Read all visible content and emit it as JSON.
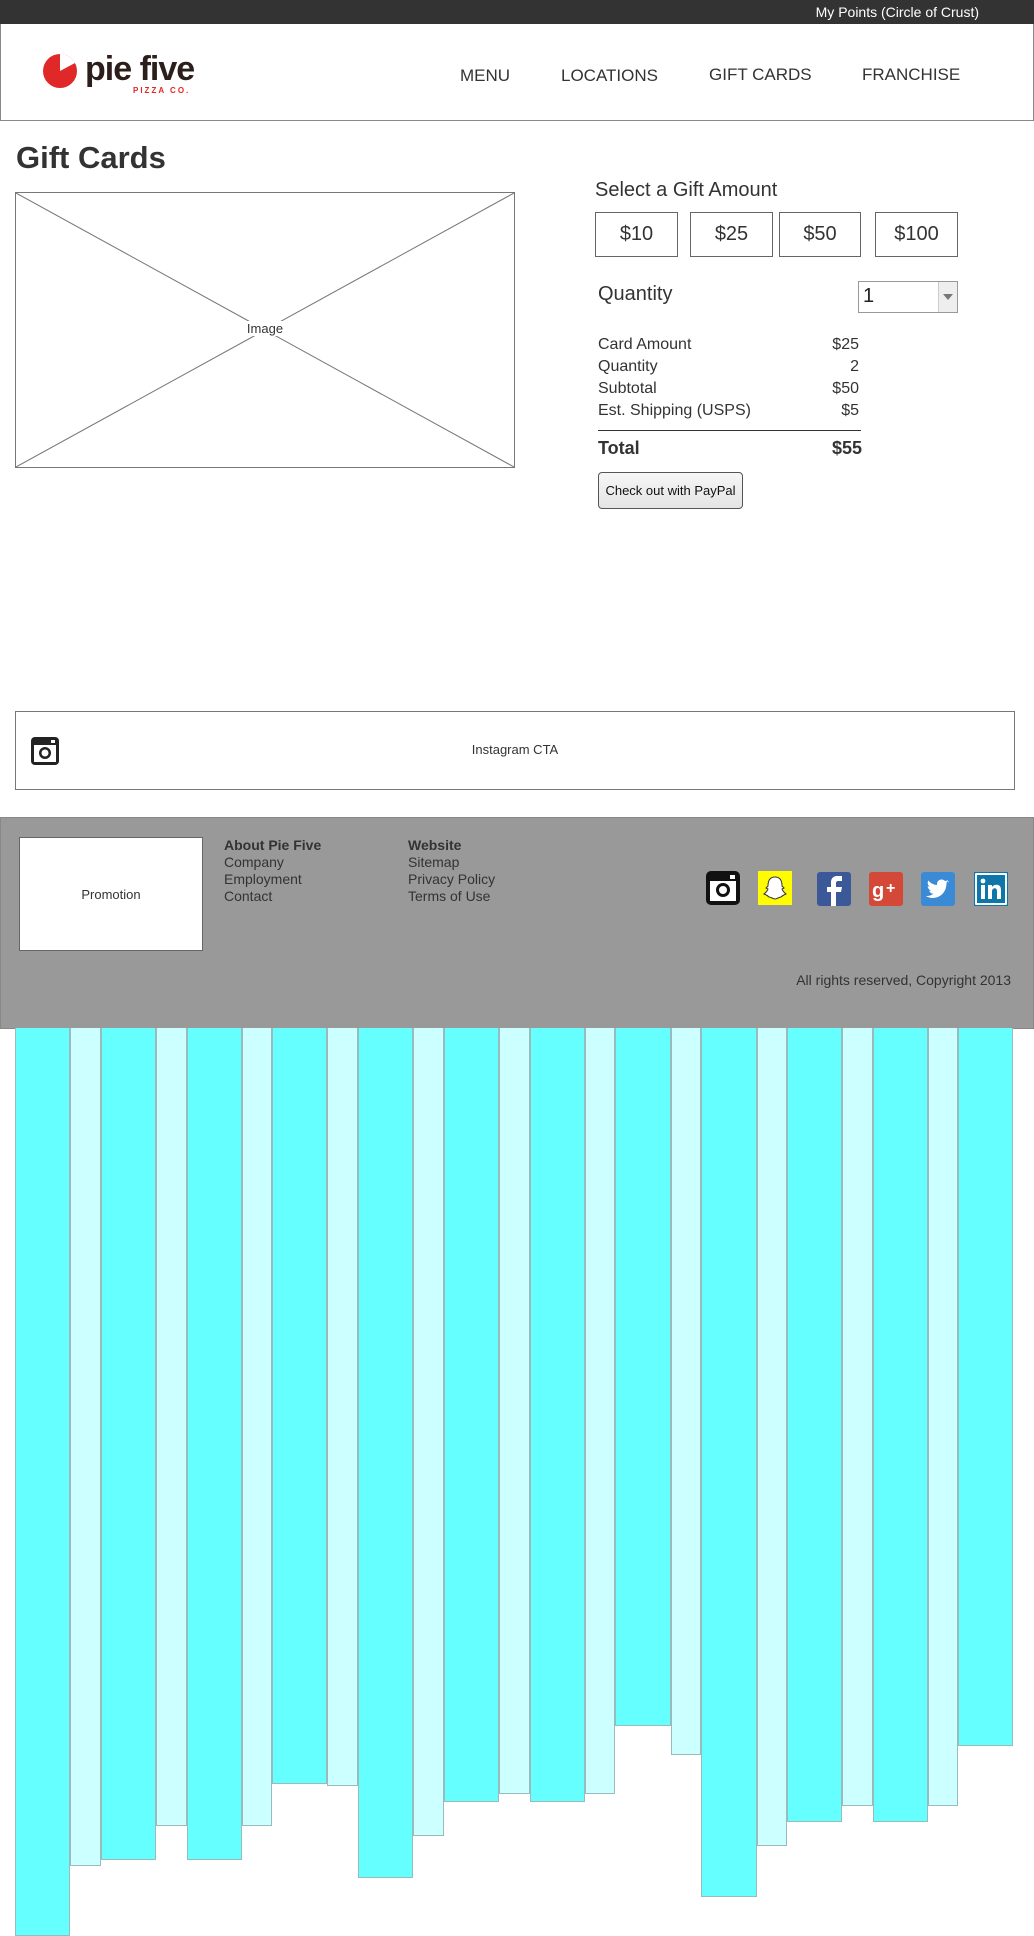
{
  "topbar": {
    "points_link": "My Points (Circle of Crust)"
  },
  "header": {
    "logo_text": "pie five",
    "logo_sub": "PIZZA CO.",
    "nav": [
      "MENU",
      "LOCATIONS",
      "GIFT CARDS",
      "FRANCHISE"
    ]
  },
  "page": {
    "title": "Gift Cards",
    "image_label": "Image"
  },
  "gift": {
    "heading": "Select a Gift Amount",
    "amounts": [
      "$10",
      "$25",
      "$50",
      "$100"
    ],
    "quantity_label": "Quantity",
    "quantity_value": "1",
    "summary": [
      {
        "label": "Card Amount",
        "value": "$25"
      },
      {
        "label": "Quantity",
        "value": "2"
      },
      {
        "label": "Subtotal",
        "value": "$50"
      },
      {
        "label": "Est. Shipping (USPS)",
        "value": "$5"
      }
    ],
    "total_label": "Total",
    "total_value": "$55",
    "checkout_label": "Check out with PayPal"
  },
  "instagram_cta": {
    "label": "Instagram CTA",
    "icon": "instagram-icon"
  },
  "footer": {
    "promo_label": "Promotion",
    "about": {
      "heading": "About Pie Five",
      "links": [
        "Company",
        "Employment",
        "Contact"
      ]
    },
    "website": {
      "heading": "Website",
      "links": [
        "Sitemap",
        "Privacy Policy",
        "Terms of Use"
      ]
    },
    "social_icons": [
      "instagram-icon",
      "snapchat-icon",
      "facebook-icon",
      "google-plus-icon",
      "twitter-icon",
      "linkedin-icon"
    ],
    "copyright": "All rights reserved, Copyright 2013"
  },
  "colors": {
    "topbar": "#333333",
    "footer": "#999999",
    "logo_red": "#e02828",
    "column_dark": "#66ffff",
    "column_light": "#ccffff"
  }
}
